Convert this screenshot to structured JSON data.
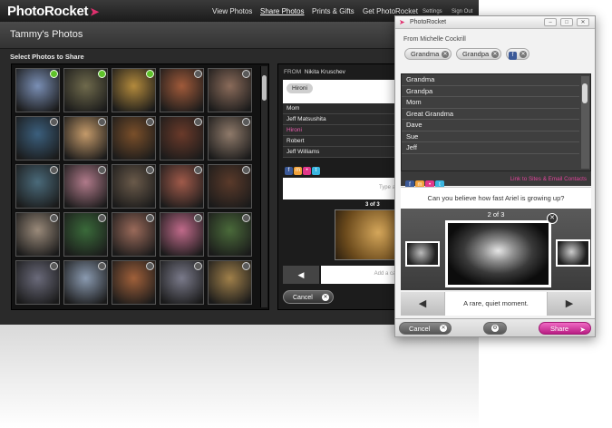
{
  "app": {
    "logo": "PhotoRocket",
    "nav": [
      "View Photos",
      "Share Photos",
      "Prints & Gifts",
      "Get PhotoRocket"
    ],
    "nav_small": [
      "Settings",
      "Sign Out"
    ],
    "active_nav": "Share Photos",
    "album_title": "Tammy's Photos",
    "select_label": "Select Photos to Share"
  },
  "grid": {
    "photos": [
      {
        "color": "#7a8fb5",
        "selected": true
      },
      {
        "color": "#6f6a4c",
        "selected": true
      },
      {
        "color": "#b38a3c",
        "selected": true
      },
      {
        "color": "#a05a3a",
        "selected": false
      },
      {
        "color": "#8a6b5a",
        "selected": false
      },
      {
        "color": "#3b5f7d",
        "selected": false
      },
      {
        "color": "#c49a6a",
        "selected": false
      },
      {
        "color": "#7a4f2a",
        "selected": false
      },
      {
        "color": "#6a3a2a",
        "selected": false
      },
      {
        "color": "#8f7a6a",
        "selected": false
      },
      {
        "color": "#4a6a7a",
        "selected": false
      },
      {
        "color": "#b07a8a",
        "selected": false
      },
      {
        "color": "#6a5a4a",
        "selected": false
      },
      {
        "color": "#a05a4a",
        "selected": false
      },
      {
        "color": "#5a3a2a",
        "selected": false
      },
      {
        "color": "#9a8a7a",
        "selected": false
      },
      {
        "color": "#3a6a3a",
        "selected": false
      },
      {
        "color": "#9a6a5a",
        "selected": false
      },
      {
        "color": "#c06a8a",
        "selected": false
      },
      {
        "color": "#4a6a3a",
        "selected": false
      },
      {
        "color": "#6a6a7a",
        "selected": false
      },
      {
        "color": "#8a9ab0",
        "selected": false
      },
      {
        "color": "#a0603a",
        "selected": false
      },
      {
        "color": "#7a7a8a",
        "selected": false
      },
      {
        "color": "#a0804a",
        "selected": false
      }
    ]
  },
  "share_panel": {
    "from_label": "FROM",
    "from_name": "Nikita Kruschev",
    "recipient_chip": "Hironi",
    "contacts": [
      "Mom",
      "Jeff Matsushita",
      "Hironi",
      "Robert",
      "Jeff Williams"
    ],
    "highlighted_contact": "Hironi",
    "note_placeholder": "Type a note here",
    "count": "3 of 3",
    "caption_placeholder": "Add a caption here",
    "cancel_label": "Cancel"
  },
  "popup": {
    "title": "PhotoRocket",
    "from": "From Michelle Cockrill",
    "recipients": [
      "Grandma",
      "Grandpa"
    ],
    "contacts": [
      "Grandma",
      "Grandpa",
      "Mom",
      "Great Grandma",
      "Dave",
      "Sue",
      "Jeff"
    ],
    "link_label": "Link to Sites & Email Contacts",
    "question": "Can you believe how fast Ariel is growing up?",
    "count": "2 of 3",
    "caption": "A rare, quiet moment.",
    "cancel_label": "Cancel",
    "share_label": "Share",
    "services": [
      "fb",
      "ms",
      "fl",
      "tw"
    ]
  },
  "colors": {
    "accent_pink": "#e0449b",
    "selected_green": "#5ec22a",
    "highlight_pink": "#ec5fb0"
  }
}
